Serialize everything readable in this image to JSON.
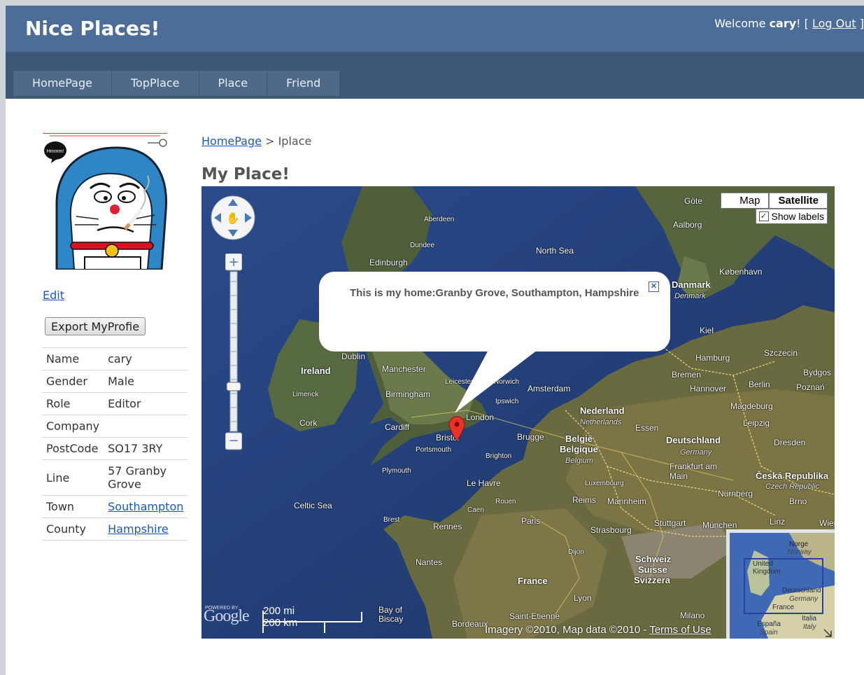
{
  "header": {
    "site_title": "Nice Places!",
    "welcome_prefix": "Welcome ",
    "username": "cary",
    "welcome_suffix": "! [ ",
    "logout_label": "Log Out",
    "welcome_close": " ]"
  },
  "nav": {
    "tabs": [
      "HomePage",
      "TopPlace",
      "Place",
      "Friend"
    ]
  },
  "sidebar": {
    "avatar_caption": "Hmmm!",
    "edit_label": "Edit",
    "export_label": "Export MyProfie",
    "profile": [
      {
        "key": "Name",
        "value": "cary"
      },
      {
        "key": "Gender",
        "value": "Male"
      },
      {
        "key": "Role",
        "value": "Editor"
      },
      {
        "key": "Company",
        "value": ""
      },
      {
        "key": "PostCode",
        "value": "SO17 3RY"
      },
      {
        "key": "Line",
        "value": "57 Granby Grove"
      },
      {
        "key": "Town",
        "value": "Southampton"
      },
      {
        "key": "County",
        "value": "Hampshire"
      }
    ]
  },
  "main": {
    "breadcrumb_home": "HomePage",
    "breadcrumb_sep": " > ",
    "breadcrumb_current": "Iplace",
    "title": "My Place!"
  },
  "map": {
    "map_button": "Map",
    "satellite_button": "Satellite",
    "show_labels": "Show labels",
    "infowindow_text": "This is my home:Granby Grove, Southampton, Hampshire",
    "scale_mi": "200 mi",
    "scale_km": "200 km",
    "powered_by": "POWERED BY",
    "google": "Google",
    "imagery": "Imagery ©2010",
    "mapdata": "Map data ©2010",
    "terms": "Terms of Use",
    "labels": {
      "north_sea": "North Sea",
      "celtic_sea": "Celtic Sea",
      "bay": "Bay of Biscay",
      "edinburgh": "Edinburgh",
      "aberdeen": "Aberdeen",
      "dundee": "Dundee",
      "dublin": "Dublin",
      "ireland": "Ireland",
      "limerick": "Limerick",
      "cork": "Cork",
      "manchester": "Manchester",
      "birmingham": "Birmingham",
      "cardiff": "Cardiff",
      "london": "London",
      "bristol": "Bristol",
      "portsmouth": "Portsmouth",
      "plymouth": "Plymouth",
      "brighton": "Brighton",
      "norwich": "Norwich",
      "ipswich": "Ipswich",
      "leicester": "Leicester",
      "amsterdam": "Amsterdam",
      "nederland": "Nederland",
      "netherlands": "Netherlands",
      "belgie": "België",
      "belgique": "Belgique",
      "belgium": "Belgium",
      "brugge": "Brugge",
      "essen": "Essen",
      "deutschland": "Deutschland",
      "germany": "Germany",
      "hamburg": "Hamburg",
      "bremen": "Bremen",
      "hannover": "Hannover",
      "berlin": "Berlin",
      "magdeburg": "Magdeburg",
      "leipzig": "Leipzig",
      "dresden": "Dresden",
      "frankfurt": "Frankfurt am Main",
      "nurnberg": "Nürnberg",
      "munchen": "München",
      "stuttgart": "Stuttgart",
      "strasbourg": "Strasbourg",
      "luxembourg": "Luxembourg",
      "cesko": "Česká Republika",
      "czech": "Czech Republic",
      "danmark": "Danmark",
      "denmark": "Denmark",
      "kobenhavn": "København",
      "aalborg": "Aalborg",
      "kiel": "Kiel",
      "szczecin": "Szczecin",
      "poznan": "Poznań",
      "bydgoszcz": "Bydgos",
      "le_havre": "Le Havre",
      "rouen": "Rouen",
      "caen": "Caen",
      "paris": "Paris",
      "reims": "Reims",
      "rennes": "Rennes",
      "nantes": "Nantes",
      "brest": "Brest",
      "france": "France",
      "bordeaux": "Bordeaux",
      "saint_etienne": "Saint-Etienne",
      "lyon": "Lyon",
      "dijon": "Dijon",
      "milano": "Milano",
      "schweiz": "Schweiz",
      "suisse": "Suisse",
      "svizzera": "Svizzera",
      "mannheim": "Mannheim",
      "brno": "Brno",
      "wien": "Wien",
      "linz": "Linz",
      "goteborg": "Göte"
    },
    "overview": {
      "norge": "Norge",
      "norway": "Norway",
      "uk": "United Kingdom",
      "deutschland": "Deutschland",
      "germany": "Germany",
      "france": "France",
      "espana": "España",
      "spain": "Spain",
      "italia": "Italia",
      "italy": "Italy"
    }
  }
}
